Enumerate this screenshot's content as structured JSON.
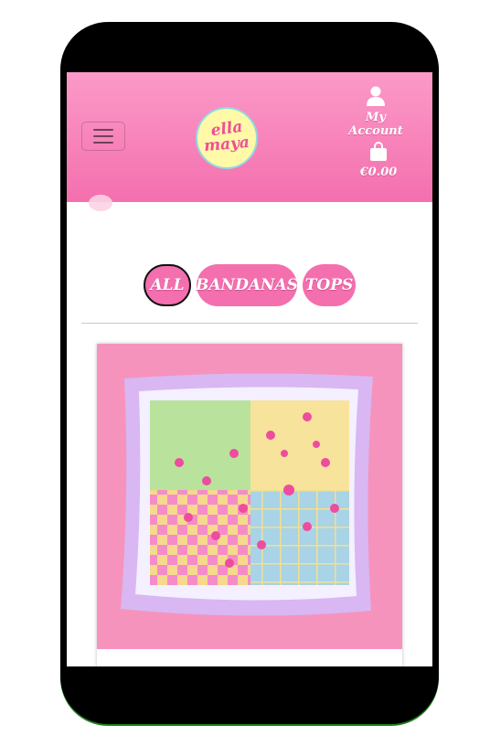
{
  "brand": {
    "logo_line1": "ella",
    "logo_line2": "maya",
    "colors": {
      "header": "#f46fae",
      "pill": "#f46fae",
      "logo_bg": "#fff9a8"
    }
  },
  "header": {
    "menu_icon": "hamburger-icon",
    "account": {
      "icon": "user-icon",
      "label": "My Account"
    },
    "cart": {
      "icon": "bag-icon",
      "total": "€0.00"
    }
  },
  "filters": [
    {
      "label": "ALL",
      "active": true
    },
    {
      "label": "BANDANAS",
      "active": false
    },
    {
      "label": "TOPS",
      "active": false
    }
  ],
  "product": {
    "image": "floral checkered silk scarf on pink background"
  }
}
